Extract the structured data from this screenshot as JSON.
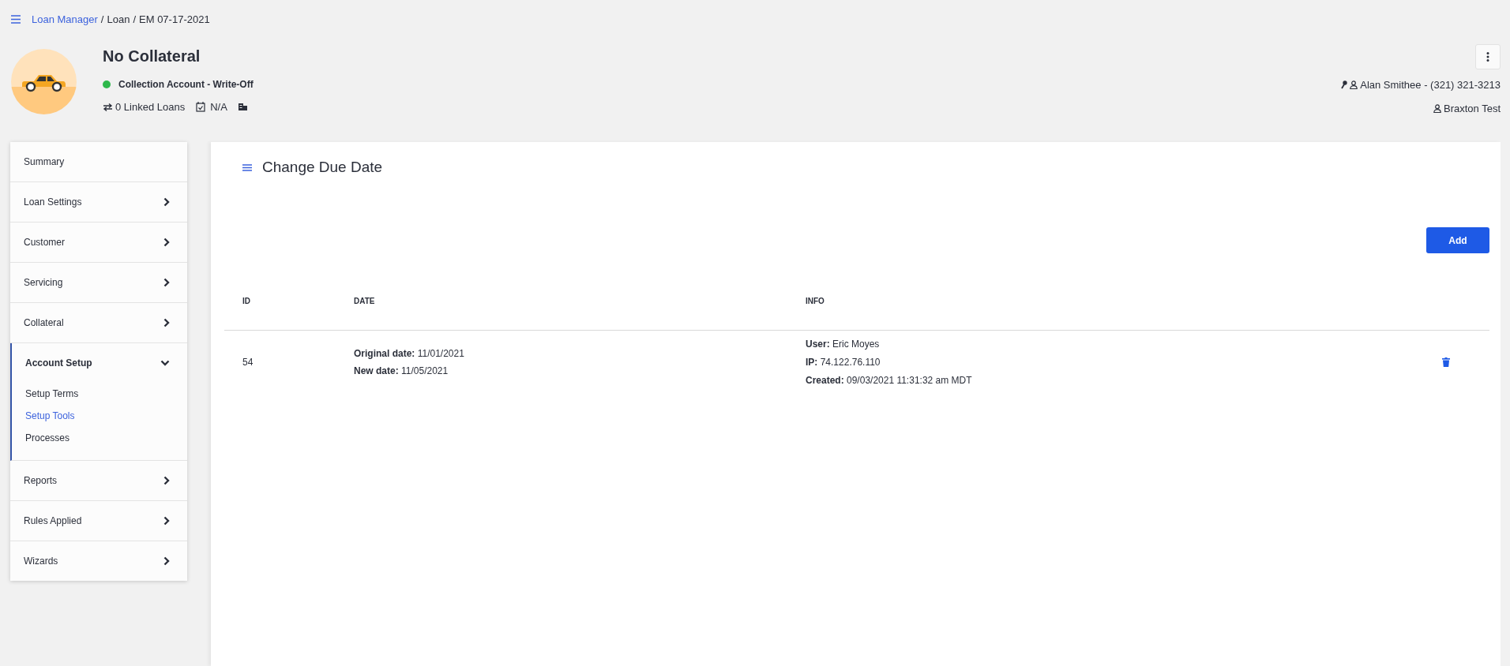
{
  "breadcrumb_separator": "/",
  "breadcrumb": [
    {
      "label": "Loan Manager",
      "kind": "link"
    },
    {
      "label": "Loan",
      "kind": "text"
    },
    {
      "label": "EM 07-17-2021",
      "kind": "text"
    }
  ],
  "loan": {
    "title": "No Collateral",
    "status": {
      "label": "Collection Account - Write-Off",
      "color": "#2eb84b"
    },
    "linked_loans": "0 Linked Loans",
    "date": "N/A"
  },
  "contacts": {
    "primary": "Alan Smithee - (321) 321-3213",
    "secondary": "Braxton Test"
  },
  "sidebar": {
    "items": [
      {
        "label": "Summary",
        "kind": "link"
      },
      {
        "label": "Loan Settings",
        "kind": "group",
        "expanded": false
      },
      {
        "label": "Customer",
        "kind": "group",
        "expanded": false
      },
      {
        "label": "Servicing",
        "kind": "group",
        "expanded": false
      },
      {
        "label": "Collateral",
        "kind": "group",
        "expanded": false
      },
      {
        "label": "Account Setup",
        "kind": "group",
        "expanded": true,
        "children": [
          {
            "label": "Setup Terms",
            "selected": false
          },
          {
            "label": "Setup Tools",
            "selected": true
          },
          {
            "label": "Processes",
            "selected": false
          }
        ]
      },
      {
        "label": "Reports",
        "kind": "group",
        "expanded": false
      },
      {
        "label": "Rules Applied",
        "kind": "group",
        "expanded": false
      },
      {
        "label": "Wizards",
        "kind": "group",
        "expanded": false
      }
    ]
  },
  "panel": {
    "title": "Change Due Date",
    "add_button": "Add",
    "table": {
      "columns": [
        "ID",
        "DATE",
        "INFO"
      ],
      "rows": [
        {
          "id": "54",
          "date": [
            "**Original date:** 11/01/2021",
            "**New date:** 11/05/2021"
          ],
          "info": [
            "**User:** Eric Moyes",
            "**IP:** 74.122.76.110",
            "**Created:** 09/03/2021 11:31:32 am MDT"
          ]
        }
      ]
    }
  }
}
